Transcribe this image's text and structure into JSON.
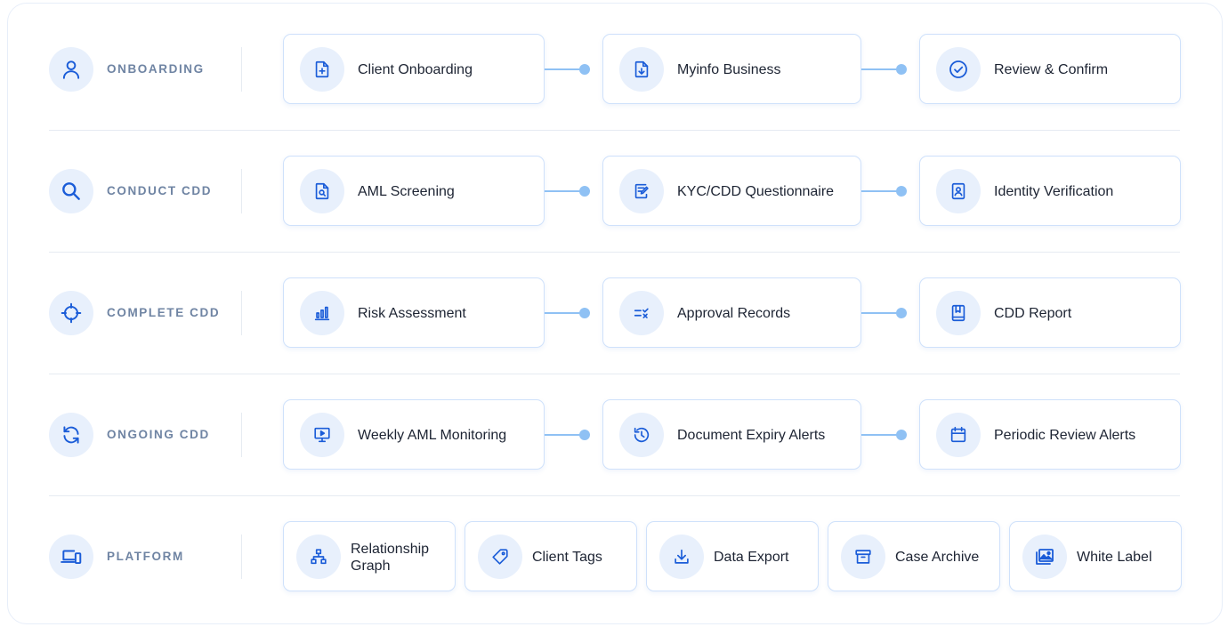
{
  "stages": [
    {
      "label": "ONBOARDING",
      "icon": "user-icon",
      "steps": [
        {
          "label": "Client Onboarding",
          "icon": "file-plus-icon"
        },
        {
          "label": "Myinfo Business",
          "icon": "file-download-icon"
        },
        {
          "label": "Review & Confirm",
          "icon": "check-circle-icon"
        }
      ]
    },
    {
      "label": "CONDUCT CDD",
      "icon": "search-icon",
      "steps": [
        {
          "label": "AML Screening",
          "icon": "file-search-icon"
        },
        {
          "label": "KYC/CDD Questionnaire",
          "icon": "form-edit-icon"
        },
        {
          "label": "Identity Verification",
          "icon": "id-badge-icon"
        }
      ]
    },
    {
      "label": "COMPLETE CDD",
      "icon": "crosshair-icon",
      "steps": [
        {
          "label": "Risk Assessment",
          "icon": "bar-chart-icon"
        },
        {
          "label": "Approval Records",
          "icon": "list-check-icon"
        },
        {
          "label": "CDD Report",
          "icon": "book-icon"
        }
      ]
    },
    {
      "label": "ONGOING CDD",
      "icon": "refresh-icon",
      "steps": [
        {
          "label": "Weekly AML Monitoring",
          "icon": "monitor-play-icon"
        },
        {
          "label": "Document Expiry Alerts",
          "icon": "history-icon"
        },
        {
          "label": "Periodic Review Alerts",
          "icon": "calendar-icon"
        }
      ]
    }
  ],
  "platform": {
    "label": "PLATFORM",
    "icon": "devices-icon",
    "features": [
      {
        "label": "Relationship Graph",
        "icon": "hierarchy-icon"
      },
      {
        "label": "Client Tags",
        "icon": "tag-icon"
      },
      {
        "label": "Data Export",
        "icon": "download-icon"
      },
      {
        "label": "Case Archive",
        "icon": "archive-icon"
      },
      {
        "label": "White Label",
        "icon": "images-icon"
      }
    ]
  },
  "colors": {
    "accent": "#1a5cd8",
    "icon_bg": "#e8f0fc",
    "card_border": "#cfe1fb",
    "connector": "#8fc1f4",
    "stage_label": "#6f84a3",
    "text": "#1d2433"
  }
}
